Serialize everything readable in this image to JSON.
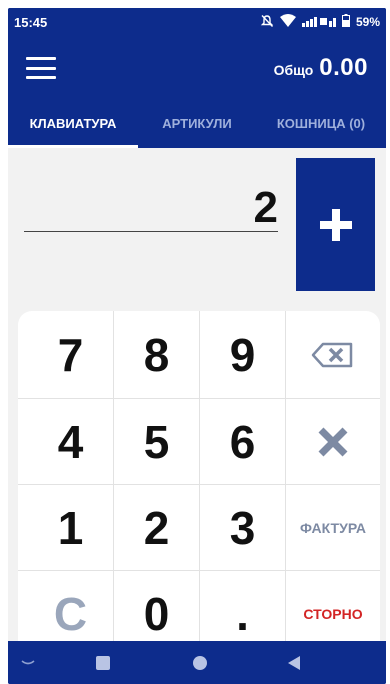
{
  "status": {
    "time": "15:45",
    "battery": "59%"
  },
  "header": {
    "total_label": "Общо",
    "total_value": "0.00"
  },
  "tabs": [
    {
      "label": "КЛАВИАТУРА"
    },
    {
      "label": "АРТИКУЛИ"
    },
    {
      "label": "КОШНИЦА (0)"
    }
  ],
  "quantity": "2",
  "keys": {
    "k7": "7",
    "k8": "8",
    "k9": "9",
    "k4": "4",
    "k5": "5",
    "k6": "6",
    "k1": "1",
    "k2": "2",
    "k3": "3",
    "clear": "C",
    "k0": "0",
    "dot": ".",
    "invoice": "ФАКТУРА",
    "storno": "СТОРНО"
  },
  "colors": {
    "primary": "#0d2c8c",
    "storno": "#d32525",
    "muted_key": "#7d8aa3"
  },
  "icons": [
    "menu-icon",
    "plus-icon",
    "backspace-icon",
    "close-icon",
    "mute-icon",
    "wifi-icon",
    "signal-icon",
    "battery-icon",
    "nav-collapse-icon",
    "nav-home-icon",
    "nav-recents-icon",
    "nav-back-icon"
  ]
}
